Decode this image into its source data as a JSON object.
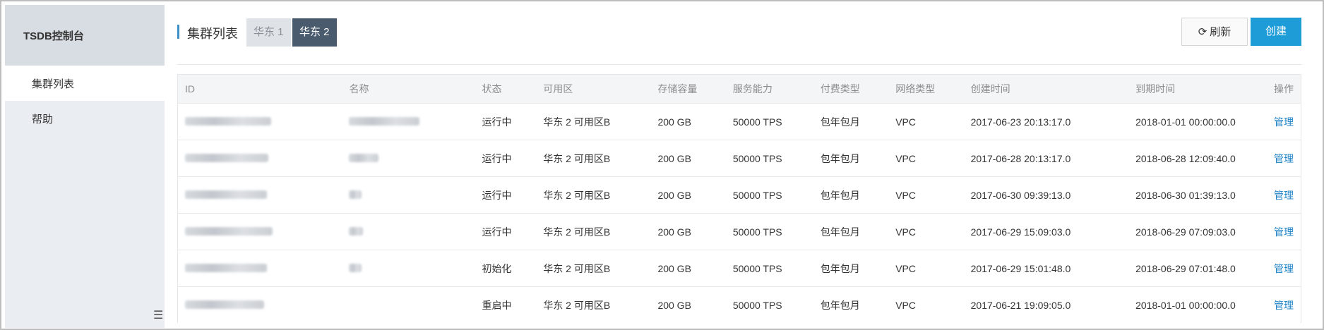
{
  "sidebar": {
    "title": "TSDB控制台",
    "items": [
      {
        "label": "集群列表",
        "active": true
      },
      {
        "label": "帮助",
        "active": false
      }
    ],
    "collapse_icon": "menu-lines-icon"
  },
  "header": {
    "title": "集群列表",
    "tabs": [
      {
        "label": "华东 1",
        "active": false
      },
      {
        "label": "华东 2",
        "active": true
      }
    ],
    "refresh_label": "刷新",
    "refresh_icon": "refresh-icon",
    "create_label": "创建"
  },
  "colors": {
    "accent": "#1d9cd8",
    "active_tab": "#4a5b6e",
    "link": "#1d83c6"
  },
  "table": {
    "columns": [
      "ID",
      "名称",
      "状态",
      "可用区",
      "存储容量",
      "服务能力",
      "付费类型",
      "网络类型",
      "创建时间",
      "到期时间",
      "操作"
    ],
    "rows": [
      {
        "status": "运行中",
        "zone": "华东 2 可用区B",
        "storage": "200 GB",
        "capacity": "50000 TPS",
        "billing": "包年包月",
        "network": "VPC",
        "created": "2017-06-23 20:13:17.0",
        "expires": "2018-01-01 00:00:00.0",
        "action": "管理"
      },
      {
        "status": "运行中",
        "zone": "华东 2 可用区B",
        "storage": "200 GB",
        "capacity": "50000 TPS",
        "billing": "包年包月",
        "network": "VPC",
        "created": "2017-06-28 20:13:17.0",
        "expires": "2018-06-28 12:09:40.0",
        "action": "管理"
      },
      {
        "status": "运行中",
        "zone": "华东 2 可用区B",
        "storage": "200 GB",
        "capacity": "50000 TPS",
        "billing": "包年包月",
        "network": "VPC",
        "created": "2017-06-30 09:39:13.0",
        "expires": "2018-06-30 01:39:13.0",
        "action": "管理"
      },
      {
        "status": "运行中",
        "zone": "华东 2 可用区B",
        "storage": "200 GB",
        "capacity": "50000 TPS",
        "billing": "包年包月",
        "network": "VPC",
        "created": "2017-06-29 15:09:03.0",
        "expires": "2018-06-29 07:09:03.0",
        "action": "管理"
      },
      {
        "status": "初始化",
        "zone": "华东 2 可用区B",
        "storage": "200 GB",
        "capacity": "50000 TPS",
        "billing": "包年包月",
        "network": "VPC",
        "created": "2017-06-29 15:01:48.0",
        "expires": "2018-06-29 07:01:48.0",
        "action": "管理"
      },
      {
        "status": "重启中",
        "zone": "华东 2 可用区B",
        "storage": "200 GB",
        "capacity": "50000 TPS",
        "billing": "包年包月",
        "network": "VPC",
        "created": "2017-06-21 19:09:05.0",
        "expires": "2018-01-01 00:00:00.0",
        "action": "管理"
      }
    ]
  }
}
